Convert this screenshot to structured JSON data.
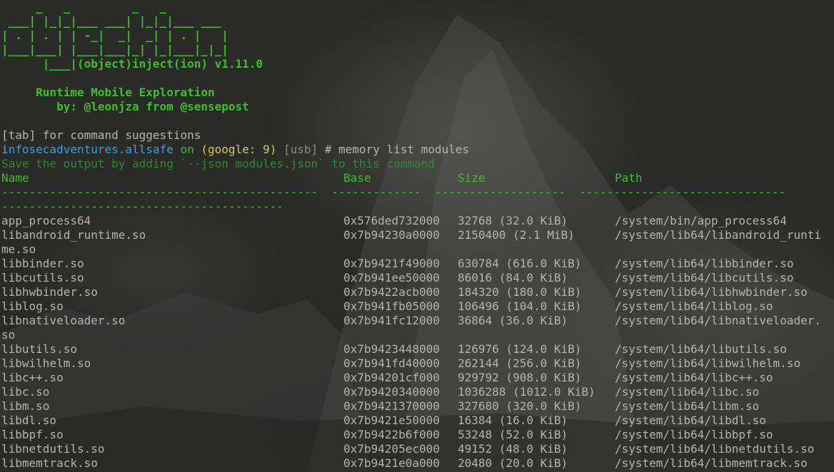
{
  "banner": {
    "ascii_lines": [
      "     _   _         _   _",
      " ___| |_|_|___ ___| |_|_|___ ___",
      "| . | . | | -_|  _|  _| | . |   |",
      "|___|___| |___|___|_| |_|___|_|_|",
      "      |___|(object)inject(ion) v1.11.0"
    ],
    "tagline": "     Runtime Mobile Exploration",
    "author": "        by: @leonjza from @sensepost"
  },
  "tab_hint": "[tab] for command suggestions",
  "prompt": {
    "host": "infosecadventures.allsafe",
    "on": " on ",
    "device": "(google: 9)",
    "transport": " [usb]",
    "command": " # memory list modules"
  },
  "save_hint": "Save the output by adding `--json modules.json` to this command",
  "table": {
    "headers": {
      "name": "Name",
      "base": "Base",
      "size": "Size",
      "path": "Path"
    },
    "separator_1": "----------------------------------------------  -------------  -------------------  ------------------------------",
    "separator_2": "-----------------------------------------",
    "rows": [
      {
        "name": "app_process64",
        "base": "0x576ded732000",
        "size": "32768 (32.0 KiB)",
        "path": "/system/bin/app_process64"
      },
      {
        "name": "libandroid_runtime.so",
        "name_wrap": "me.so",
        "base": "0x7b94230a0000",
        "size": "2150400 (2.1 MiB)",
        "path": "/system/lib64/libandroid_runti"
      },
      {
        "name": "libbinder.so",
        "base": "0x7b9421f49000",
        "size": "630784 (616.0 KiB)",
        "path": "/system/lib64/libbinder.so"
      },
      {
        "name": "libcutils.so",
        "base": "0x7b941ee50000",
        "size": "86016 (84.0 KiB)",
        "path": "/system/lib64/libcutils.so"
      },
      {
        "name": "libhwbinder.so",
        "base": "0x7b9422acb000",
        "size": "184320 (180.0 KiB)",
        "path": "/system/lib64/libhwbinder.so"
      },
      {
        "name": "liblog.so",
        "base": "0x7b941fb05000",
        "size": "106496 (104.0 KiB)",
        "path": "/system/lib64/liblog.so"
      },
      {
        "name": "libnativeloader.so",
        "name_wrap": "so",
        "base": "0x7b941fc12000",
        "size": "36864 (36.0 KiB)",
        "path": "/system/lib64/libnativeloader."
      },
      {
        "name": "libutils.so",
        "base": "0x7b9423448000",
        "size": "126976 (124.0 KiB)",
        "path": "/system/lib64/libutils.so"
      },
      {
        "name": "libwilhelm.so",
        "base": "0x7b941fd40000",
        "size": "262144 (256.0 KiB)",
        "path": "/system/lib64/libwilhelm.so"
      },
      {
        "name": "libc++.so",
        "base": "0x7b94201cf000",
        "size": "929792 (908.0 KiB)",
        "path": "/system/lib64/libc++.so"
      },
      {
        "name": "libc.so",
        "base": "0x7b9420340000",
        "size": "1036288 (1012.0 KiB)",
        "path": "/system/lib64/libc.so"
      },
      {
        "name": "libm.so",
        "base": "0x7b9421370000",
        "size": "327680 (320.0 KiB)",
        "path": "/system/lib64/libm.so"
      },
      {
        "name": "libdl.so",
        "base": "0x7b9421e50000",
        "size": "16384 (16.0 KiB)",
        "path": "/system/lib64/libdl.so"
      },
      {
        "name": "libbpf.so",
        "base": "0x7b9422b6f000",
        "size": "53248 (52.0 KiB)",
        "path": "/system/lib64/libbpf.so"
      },
      {
        "name": "libnetdutils.so",
        "base": "0x7b94205ec000",
        "size": "49152 (48.0 KiB)",
        "path": "/system/lib64/libnetdutils.so"
      },
      {
        "name": "libmemtrack.so",
        "base": "0x7b9421e0a000",
        "size": "20480 (20.0 KiB)",
        "path": "/system/lib64/libmemtrack.so"
      }
    ]
  },
  "colors": {
    "banner_green": "#3fbf2b",
    "host_blue": "#3f9fe0",
    "device_yellow": "#dcc94b",
    "text_gray": "#b4b4b4",
    "hint_green": "#2e8a2e"
  }
}
